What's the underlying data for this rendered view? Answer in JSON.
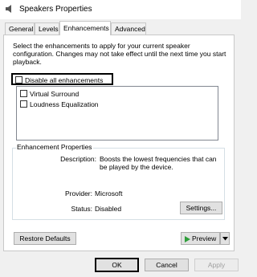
{
  "window": {
    "title": "Speakers Properties"
  },
  "tabs": [
    {
      "label": "General",
      "active": false
    },
    {
      "label": "Levels",
      "active": false
    },
    {
      "label": "Enhancements",
      "active": true
    },
    {
      "label": "Advanced",
      "active": false
    }
  ],
  "enhancements": {
    "description": "Select the enhancements to apply for your current speaker configuration. Changes may not take effect until the next time you start playback.",
    "disable_all": {
      "label": "Disable all enhancements",
      "checked": false
    },
    "items": [
      {
        "label": "Virtual Surround",
        "checked": false
      },
      {
        "label": "Loudness Equalization",
        "checked": false
      }
    ]
  },
  "properties": {
    "group_title": "Enhancement Properties",
    "description_label": "Description:",
    "description_value": "Boosts the lowest frequencies that can be played by the device.",
    "provider_label": "Provider:",
    "provider_value": "Microsoft",
    "status_label": "Status:",
    "status_value": "Disabled",
    "settings_button": "Settings..."
  },
  "buttons": {
    "restore_defaults": "Restore Defaults",
    "preview": "Preview",
    "ok": "OK",
    "cancel": "Cancel",
    "apply": "Apply"
  },
  "colors": {
    "play_green": "#2e9e3a",
    "window_bg": "#f0f0f0",
    "panel_bg": "#ffffff"
  }
}
